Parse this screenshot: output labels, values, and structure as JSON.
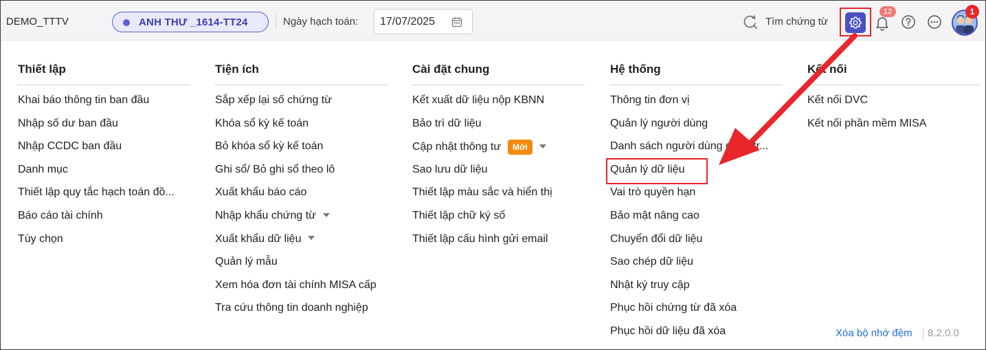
{
  "header": {
    "company": "DEMO_TTTV",
    "user": "ANH THƯ _1614-TT24",
    "date_label": "Ngày hạch toán:",
    "date_value": "17/07/2025",
    "search_label": "Tìm chứng từ",
    "notification_count": "12",
    "avatar_badge": "1"
  },
  "menu": {
    "thiet_lap": {
      "title": "Thiết lập",
      "items": [
        "Khai báo thông tin ban đầu",
        "Nhập số dư ban đầu",
        "Nhập CCDC ban đầu",
        "Danh mục",
        "Thiết lập quy tắc hạch toán đồ...",
        "Báo cáo tài chính",
        "Tùy chọn"
      ]
    },
    "tien_ich": {
      "title": "Tiện ích",
      "items": [
        "Sắp xếp lại số chứng từ",
        "Khóa sổ kỳ kế toán",
        "Bỏ khóa sổ kỳ kế toán",
        "Ghi sổ/ Bỏ ghi sổ theo lô",
        "Xuất khẩu báo cáo",
        "Nhập khẩu chứng từ",
        "Xuất khẩu dữ liệu",
        "Quản lý mẫu",
        "Xem hóa đơn tài chính MISA cấp",
        "Tra cứu thông tin doanh nghiệp"
      ]
    },
    "cai_dat_chung": {
      "title": "Cài đặt chung",
      "items": [
        "Kết xuất dữ liệu nộp KBNN",
        "Bảo trì dữ liệu",
        "Cập nhật thông tư",
        "Sao lưu dữ liệu",
        "Thiết lập màu sắc và hiển thị",
        "Thiết lập chữ ký số",
        "Thiết lập cấu hình gửi email"
      ],
      "new_badge": "Mới"
    },
    "he_thong": {
      "title": "Hệ thống",
      "items": [
        "Thông tin đơn vị",
        "Quản lý người dùng",
        "Danh sách người dùng đăng tr...",
        "Quản lý dữ liệu",
        "Vai trò quyền hạn",
        "Bảo mật nâng cao",
        "Chuyển đổi dữ liệu",
        "Sao chép dữ liệu",
        "Nhật ký truy cập",
        "Phục hồi chứng từ đã xóa",
        "Phục hồi dữ liệu đã xóa"
      ]
    },
    "ket_noi": {
      "title": "Kết nối",
      "items": [
        "Kết nối DVC",
        "Kết nối phần mềm MISA"
      ]
    }
  },
  "footer": {
    "clear_cache": "Xóa bộ nhớ đệm",
    "version": "8.2.0.0"
  },
  "colors": {
    "accent": "#4b4fc4",
    "highlight": "#e8262b",
    "new_badge": "#f28a10",
    "link": "#1f6fd1"
  }
}
